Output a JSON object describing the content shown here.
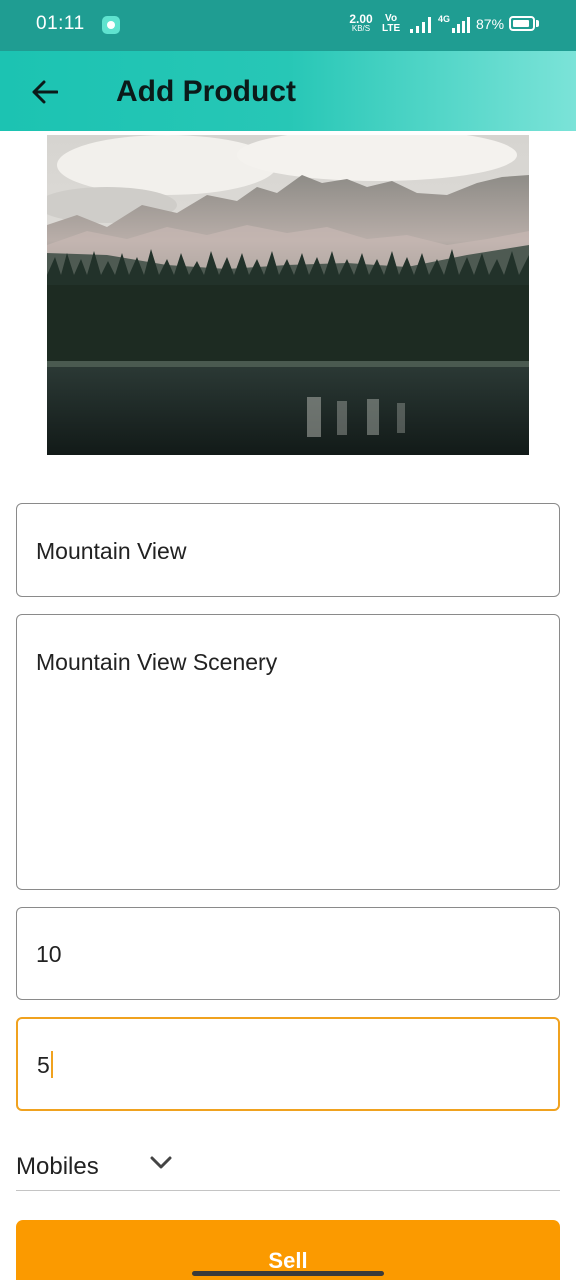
{
  "status_bar": {
    "time": "01:11",
    "speed_value": "2.00",
    "speed_unit": "KB/S",
    "volte_top": "Vo",
    "volte_bottom": "LTE",
    "net_label": "4G",
    "battery": "87%",
    "battery_level": 0.87
  },
  "app_bar": {
    "title": "Add Product",
    "back_icon": "arrow-left-icon",
    "background_color": "#1cc3b2"
  },
  "form": {
    "name_value": "Mountain View",
    "description_value": "Mountain View Scenery",
    "price_value": "10",
    "quantity_value": "5",
    "category_selected": "Mobiles",
    "focused_border_color": "#f0a21f"
  },
  "sell_button": {
    "label": "Sell",
    "color": "#fb9a00"
  }
}
